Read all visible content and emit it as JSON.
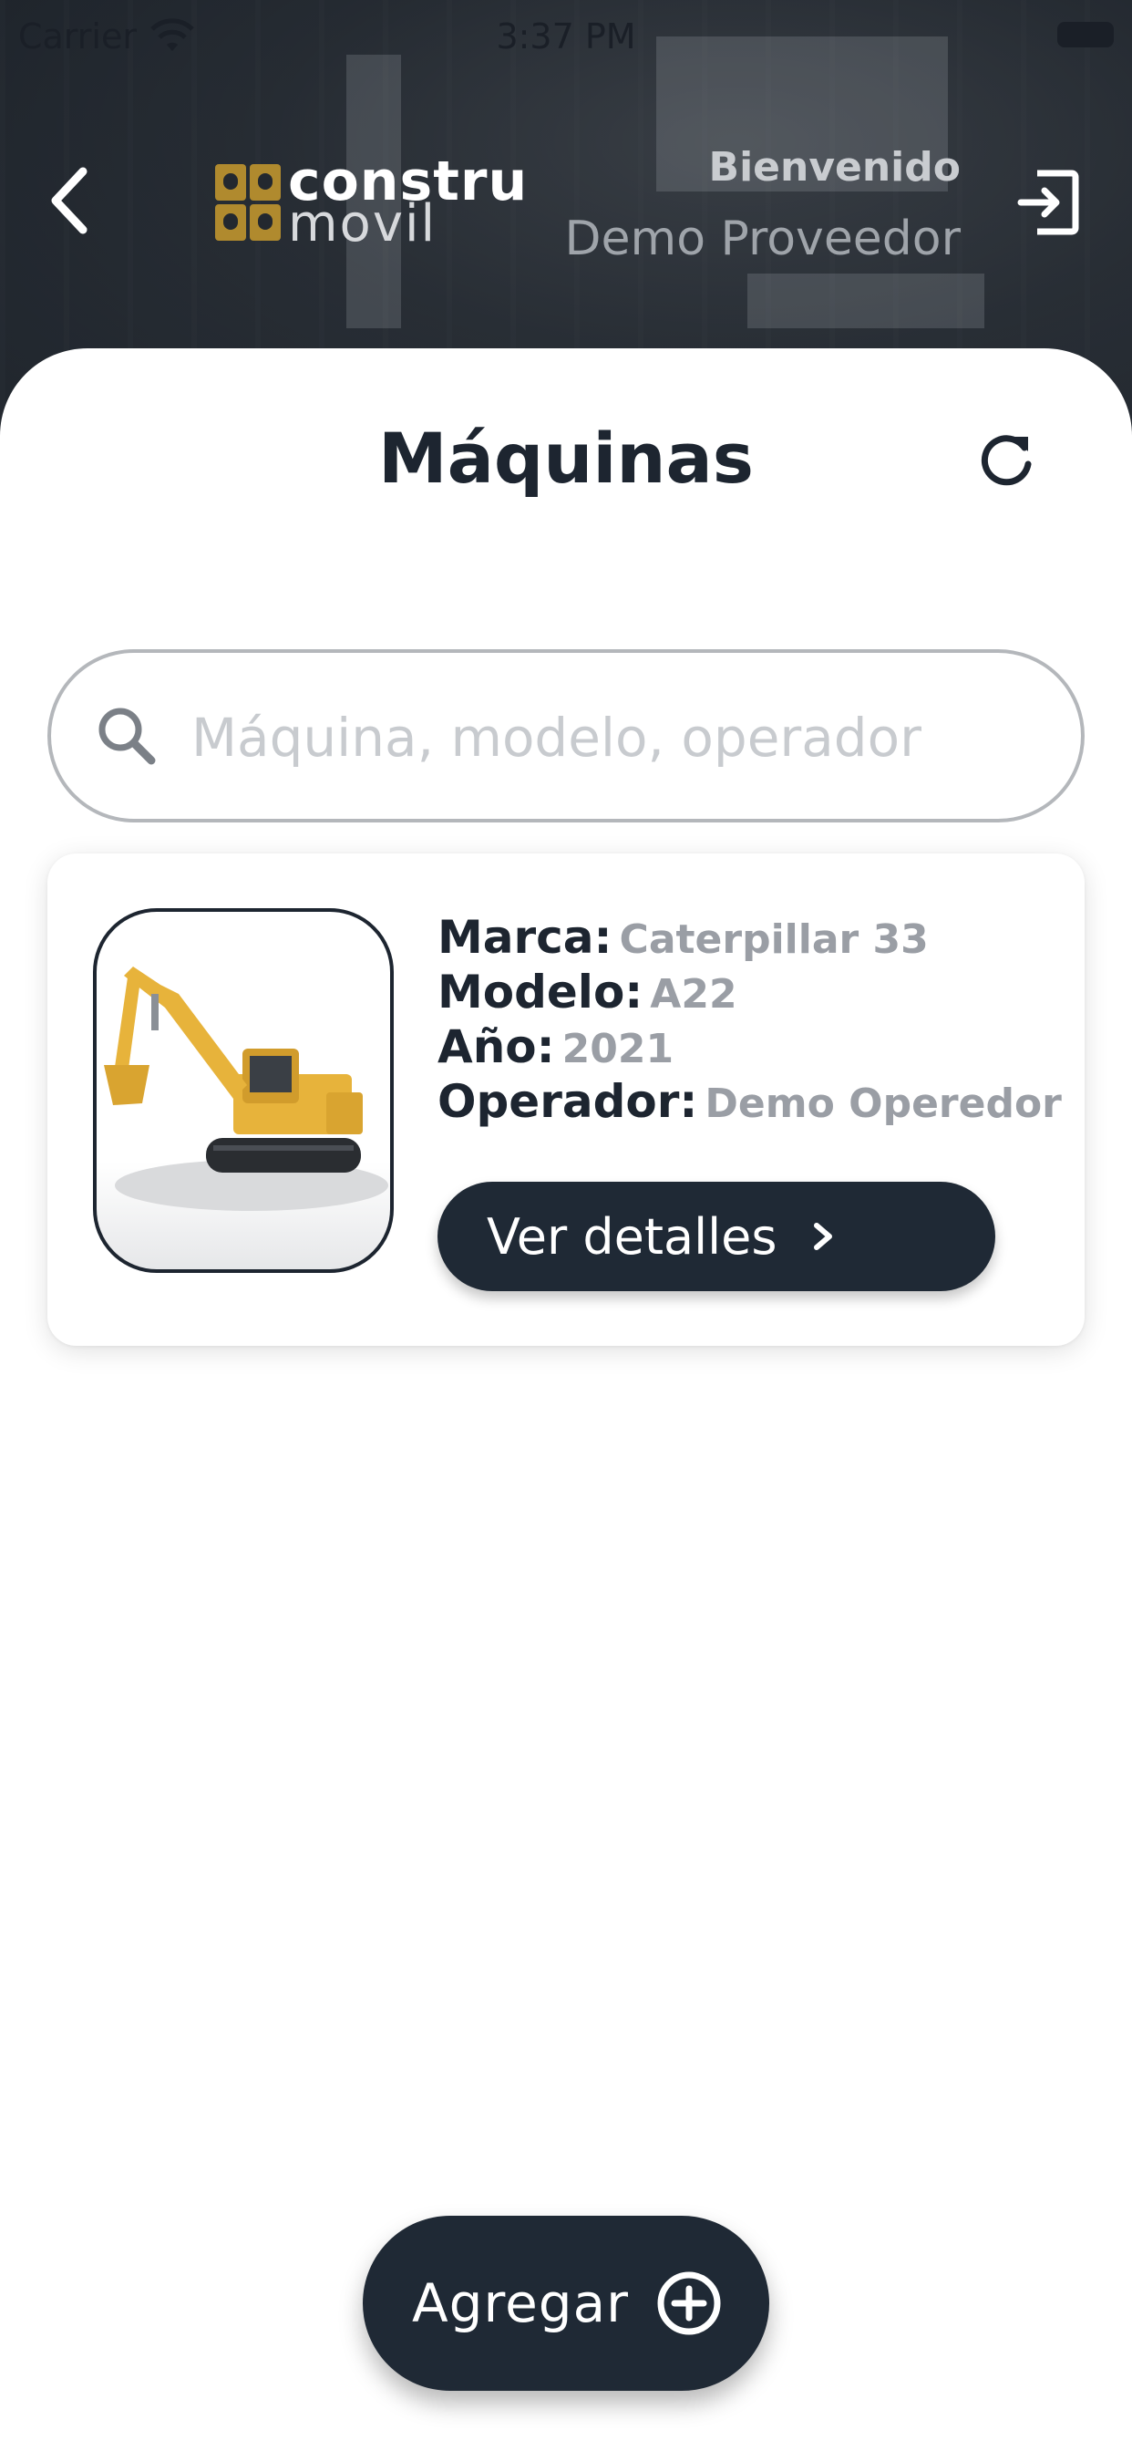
{
  "status_bar": {
    "carrier": "Carrier",
    "time": "3:37 PM",
    "icons": [
      "wifi-icon",
      "battery-icon"
    ]
  },
  "header": {
    "logo_top": "constru",
    "logo_bottom": "movil",
    "welcome": "Bienvenido",
    "user_name": "Demo Proveedor",
    "icons": [
      "back-chevron-icon",
      "logout-icon"
    ]
  },
  "main": {
    "title": "Máquinas",
    "refresh_icon": "refresh-icon"
  },
  "search": {
    "placeholder": "Máquina, modelo, operador",
    "value": "",
    "icon": "search-icon"
  },
  "machines": [
    {
      "image": "excavator-photo",
      "brand_label": "Marca:",
      "brand": "Caterpillar 33",
      "model_label": "Modelo:",
      "model": "A22",
      "year_label": "Año:",
      "year": "2021",
      "operator_label": "Operador:",
      "operator": "Demo Operedor",
      "details_button": "Ver detalles"
    }
  ],
  "add_button": {
    "label": "Agregar",
    "icon": "plus-circle-icon"
  },
  "colors": {
    "primary_dark": "#1f2935",
    "text_dark": "#1d2530",
    "value_gray": "#9a9ea5",
    "brand_gold": "#b08a2e"
  }
}
